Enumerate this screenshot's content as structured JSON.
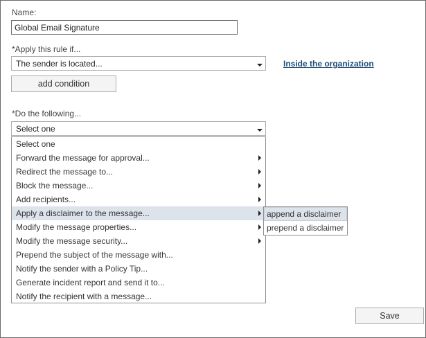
{
  "name": {
    "label": "Name:",
    "value": "Global Email Signature"
  },
  "condition": {
    "label": "*Apply this rule if...",
    "selected": "The sender is located...",
    "value_link": "Inside the organization",
    "add_button": "add condition"
  },
  "action": {
    "label": "*Do the following...",
    "selected": "Select one",
    "options": [
      {
        "label": "Select one",
        "submenu": false
      },
      {
        "label": "Forward the message for approval...",
        "submenu": true
      },
      {
        "label": "Redirect the message to...",
        "submenu": true
      },
      {
        "label": "Block the message...",
        "submenu": true
      },
      {
        "label": "Add recipients...",
        "submenu": true
      },
      {
        "label": "Apply a disclaimer to the message...",
        "submenu": true
      },
      {
        "label": "Modify the message properties...",
        "submenu": true
      },
      {
        "label": "Modify the message security...",
        "submenu": true
      },
      {
        "label": "Prepend the subject of the message with...",
        "submenu": false
      },
      {
        "label": "Notify the sender with a Policy Tip...",
        "submenu": false
      },
      {
        "label": "Generate incident report and send it to...",
        "submenu": false
      },
      {
        "label": "Notify the recipient with a message...",
        "submenu": false
      }
    ],
    "highlighted_option": "Apply a disclaimer to the message...",
    "submenu": [
      "append a disclaimer",
      "prepend a disclaimer"
    ],
    "highlighted_submenu": "append a disclaimer"
  },
  "footer": {
    "save_label": "Save"
  }
}
